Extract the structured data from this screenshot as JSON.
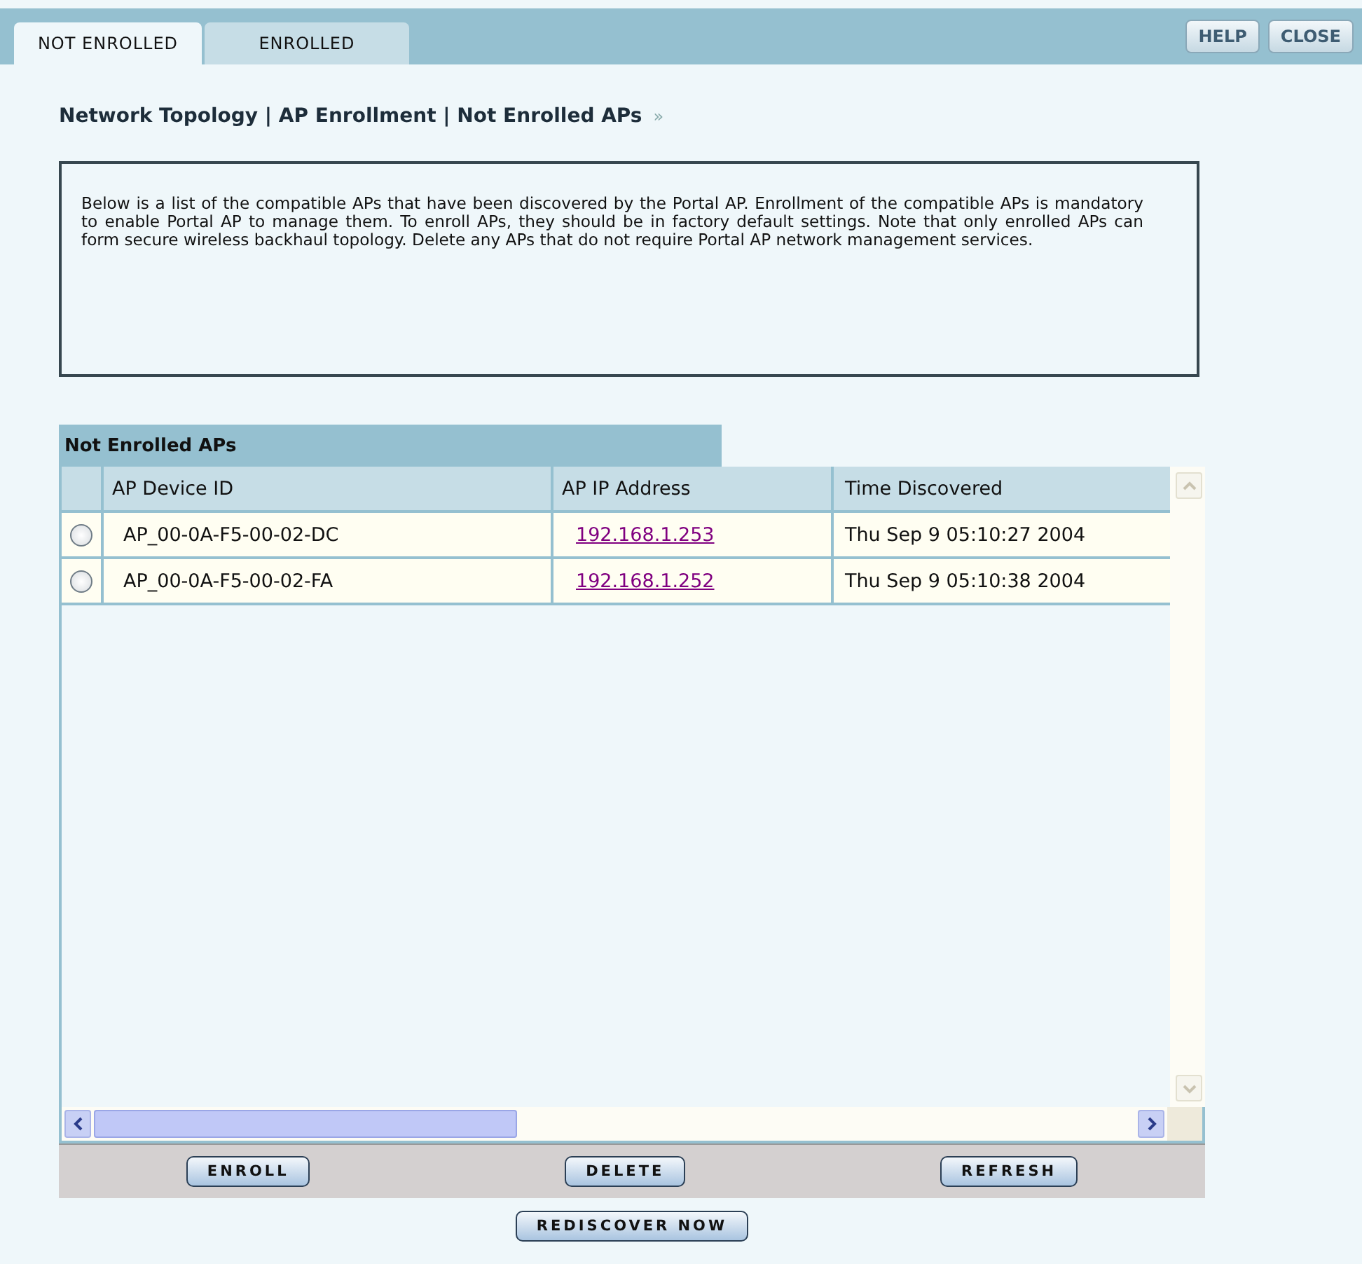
{
  "tabs": [
    {
      "label": "NOT ENROLLED",
      "selected": true
    },
    {
      "label": "ENROLLED",
      "selected": false
    }
  ],
  "header_buttons": [
    "HELP",
    "CLOSE"
  ],
  "breadcrumb": "Network Topology | AP Enrollment | Not Enrolled APs",
  "breadcrumb_icon": "»",
  "description": "Below is a list of the compatible APs that have been discovered by the Portal AP. Enrollment of the compatible APs is mandatory to enable Portal AP to manage them. To enroll APs, they should be in factory default settings. Note that only enrolled APs can form secure wireless backhaul topology. Delete any APs that do not require Portal AP network management services.",
  "table": {
    "title": "Not Enrolled APs",
    "columns": [
      "AP Device ID",
      "AP IP Address",
      "Time Discovered"
    ],
    "rows": [
      {
        "selected": false,
        "device_id": "AP_00-0A-F5-00-02-DC",
        "ip": "192.168.1.253",
        "time": "Thu Sep 9 05:10:27 2004"
      },
      {
        "selected": false,
        "device_id": "AP_00-0A-F5-00-02-FA",
        "ip": "192.168.1.252",
        "time": "Thu Sep 9 05:10:38 2004"
      }
    ]
  },
  "action_buttons": [
    "ENROLL",
    "DELETE",
    "REFRESH"
  ],
  "bottom_button": "REDISCOVER NOW"
}
